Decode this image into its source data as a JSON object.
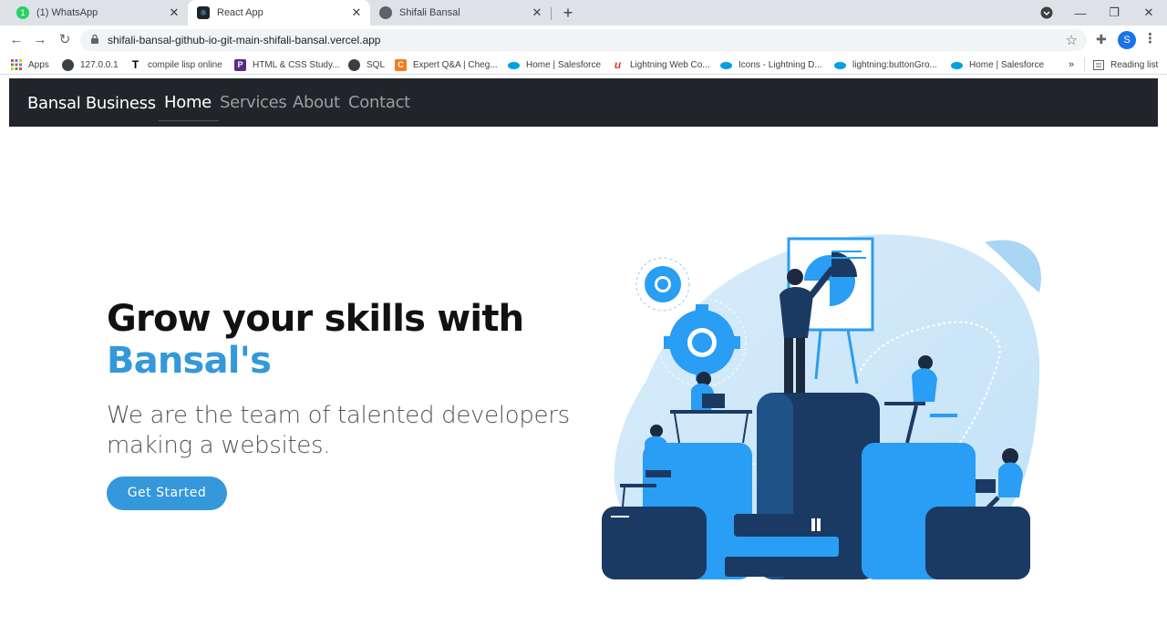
{
  "browser": {
    "tabs": [
      {
        "title": "(1) WhatsApp",
        "badge": "1"
      },
      {
        "title": "React App"
      },
      {
        "title": "Shifali Bansal"
      }
    ],
    "url": "shifali-bansal-github-io-git-main-shifali-bansal.vercel.app",
    "profile_initial": "S",
    "bookmarks": [
      "Apps",
      "127.0.0.1",
      "compile lisp online",
      "HTML & CSS Study...",
      "SQL",
      "Expert Q&A | Cheg...",
      "Home | Salesforce",
      "Lightning Web Co...",
      "Icons - Lightning D...",
      "lightning:buttonGro...",
      "Home | Salesforce"
    ],
    "bookmarks_overflow": "»",
    "reading_list": "Reading list"
  },
  "site": {
    "brand": "Bansal Business",
    "nav": [
      "Home",
      "Services",
      "About",
      "Contact"
    ],
    "headline_line1": "Grow your skills with",
    "headline_line2": "Bansal's",
    "subtitle": "We are the team of talented developers making a websites.",
    "cta": "Get Started",
    "accent": "#3498db",
    "navbar_bg": "#212529"
  }
}
